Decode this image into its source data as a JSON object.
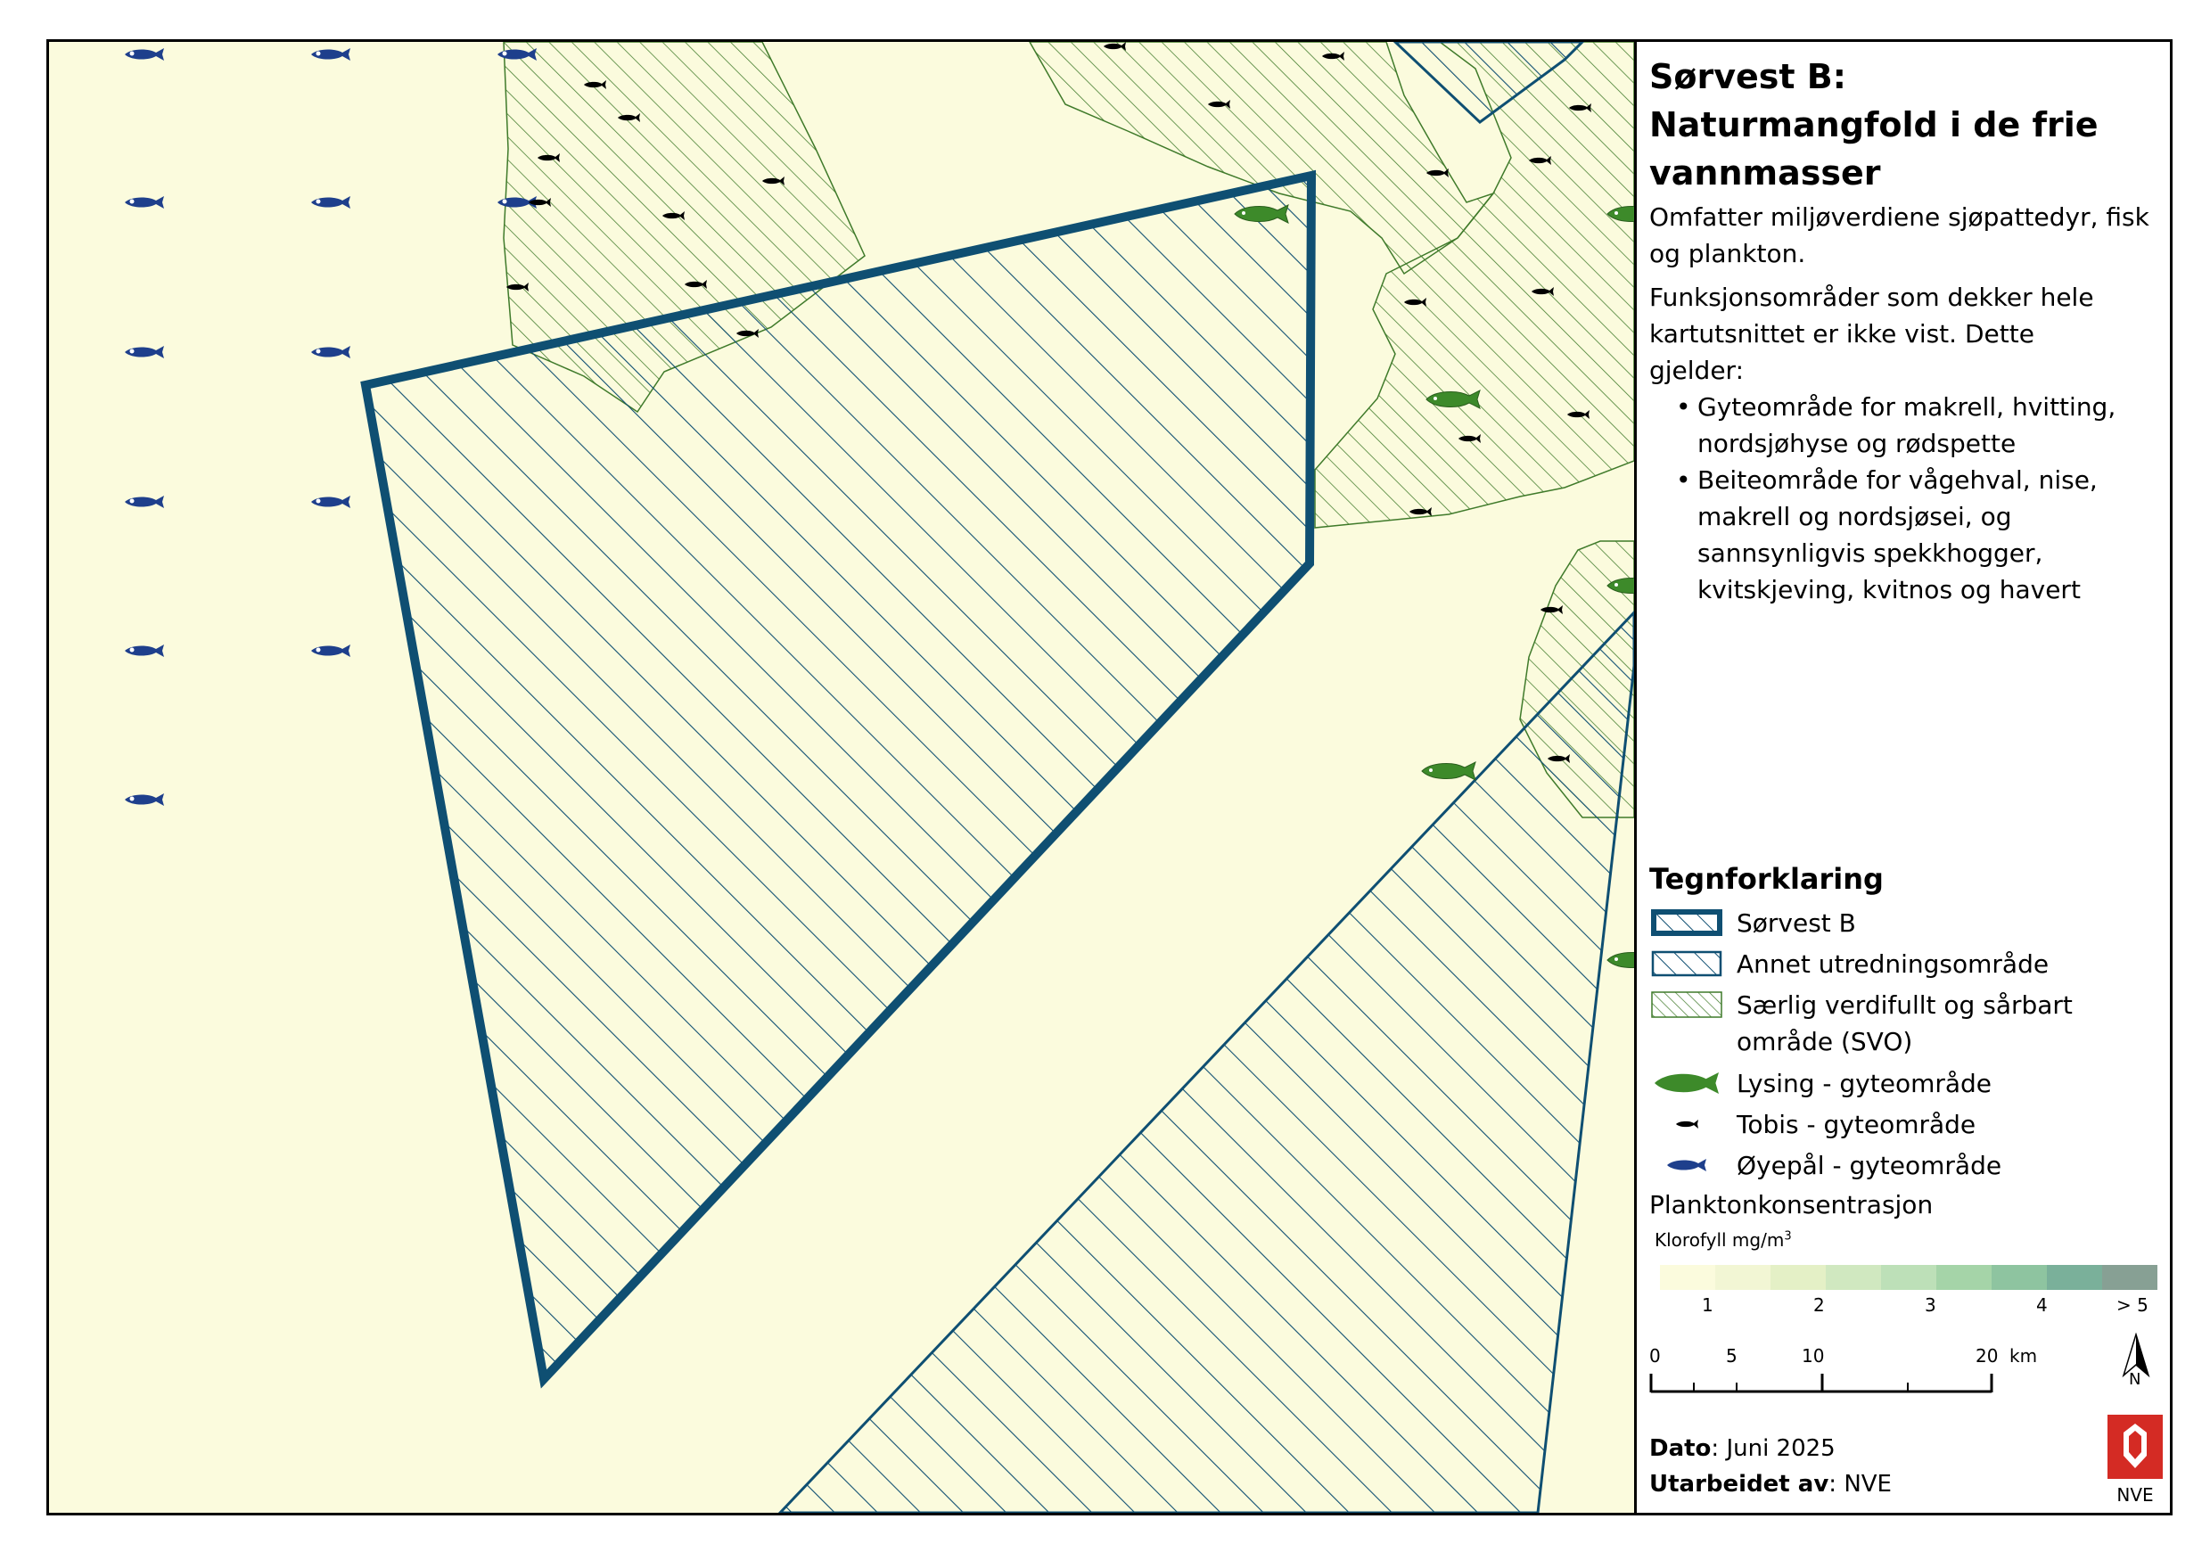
{
  "panel": {
    "title_line1": "Sørvest B:",
    "title_line2": "Naturmangfold i de frie",
    "title_line3": "vannmasser",
    "description": "Omfatter miljøverdiene sjøpattedyr, fisk og plankton.",
    "functions_intro": "Funksjonsområder som dekker hele kartutsnittet er ikke vist. Dette gjelder:",
    "bullets": [
      "Gyteområde for makrell, hvitting, nordsjøhyse og rødspette",
      "Beiteområde for vågehval, nise, makrell og nordsjøsei, og sannsynligvis spekkhogger, kvitskjeving, kvitnos og havert"
    ]
  },
  "legend": {
    "title": "Tegnforklaring",
    "items": [
      {
        "label": "Sørvest B",
        "icon": "thick-blue-hatched-box"
      },
      {
        "label": "Annet utredningsområde",
        "icon": "thin-blue-hatched-box"
      },
      {
        "label": "Særlig verdifullt og sårbart område (SVO)",
        "icon": "green-hatched-box"
      },
      {
        "label": "Lysing - gyteområde",
        "icon": "green-fish-icon"
      },
      {
        "label": "Tobis - gyteområde",
        "icon": "black-fish-icon"
      },
      {
        "label": "Øyepål - gyteområde",
        "icon": "blue-fish-icon"
      }
    ],
    "plankton_title": "Planktonkonsentrasjon",
    "klorofyll_label": "Klorofyll mg/m",
    "klorofyll_sup": "3",
    "ramp_labels": [
      "1",
      "2",
      "3",
      "4",
      "> 5"
    ],
    "ramp_colors": [
      "#fbfbdd",
      "#f2f6d4",
      "#e4f0c6",
      "#d0e8c0",
      "#bde0b8",
      "#a5d4a8",
      "#8ec4a0",
      "#7ab09a",
      "#87a094"
    ]
  },
  "scale": {
    "labels": [
      "0",
      "5",
      "10",
      "20"
    ],
    "unit": "km"
  },
  "north": "N",
  "footer": {
    "date_label": "Dato",
    "date_value": ": Juni 2025",
    "author_label": "Utarbeidet av",
    "author_value": ": NVE"
  },
  "logo_text": "NVE",
  "colors": {
    "background": "#fbfbdd",
    "study_area_blue": "#0f4f72",
    "svo_green": "#3f7a2a",
    "lysing_green": "#3d8a2a",
    "oyepal_blue": "#1e3f8c"
  }
}
